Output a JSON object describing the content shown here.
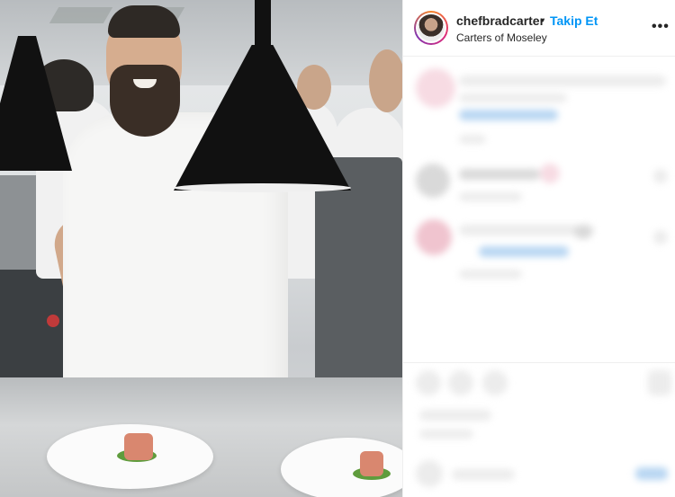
{
  "post": {
    "username": "chefbradcarter",
    "separator": "•",
    "follow_label": "Takip Et",
    "location": "Carters of Moseley",
    "more_label": "•••"
  },
  "colors": {
    "follow_blue": "#0095f6",
    "text_primary": "#262626"
  },
  "icons": {
    "more": "more-options-icon",
    "avatar": "profile-avatar"
  }
}
